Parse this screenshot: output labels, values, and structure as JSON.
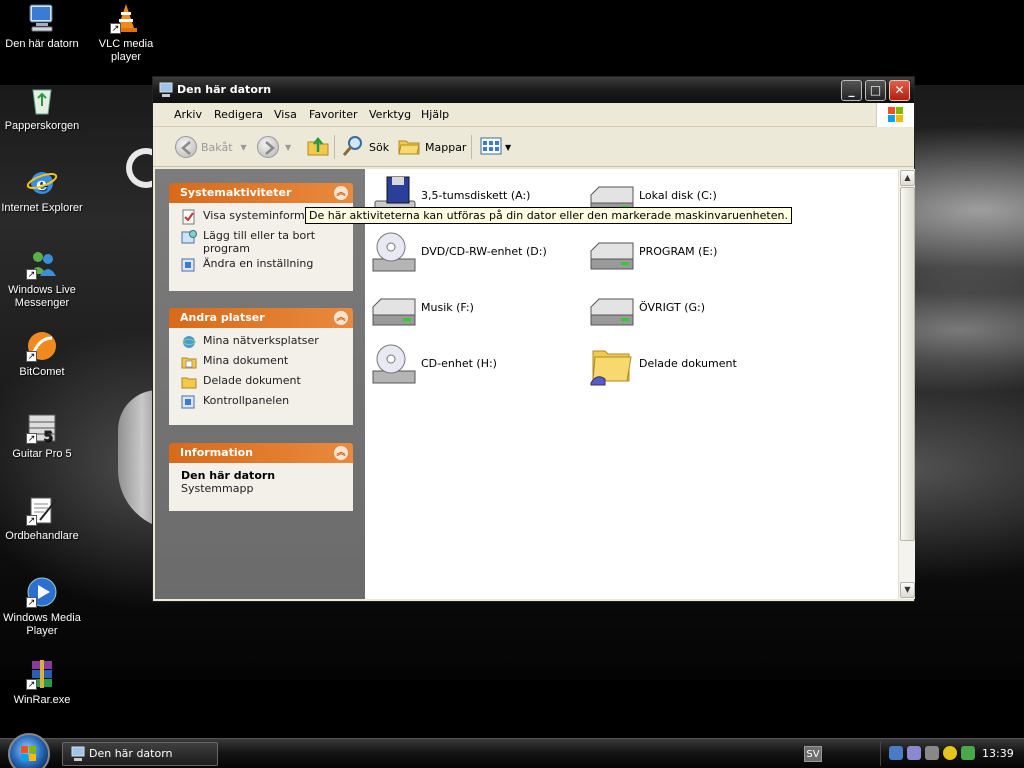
{
  "desktop": {
    "icons": [
      {
        "label": "Den här datorn",
        "icon": "computer-icon"
      },
      {
        "label": "VLC media player",
        "icon": "vlc-icon"
      },
      {
        "label": "Papperskorgen",
        "icon": "recycle-bin-icon"
      },
      {
        "label": "Internet Explorer",
        "icon": "internet-explorer-icon"
      },
      {
        "label": "Windows Live Messenger",
        "icon": "messenger-icon"
      },
      {
        "label": "BitComet",
        "icon": "bitcomet-icon"
      },
      {
        "label": "Guitar Pro 5",
        "icon": "guitar-pro-icon"
      },
      {
        "label": "Ordbehandlare",
        "icon": "word-processor-icon"
      },
      {
        "label": "Windows Media Player",
        "icon": "media-player-icon"
      },
      {
        "label": "WinRar.exe",
        "icon": "winrar-icon"
      }
    ]
  },
  "window": {
    "title": "Den här datorn",
    "menu": [
      "Arkiv",
      "Redigera",
      "Visa",
      "Favoriter",
      "Verktyg",
      "Hjälp"
    ],
    "toolbar": {
      "back": "Bakåt",
      "search": "Sök",
      "folders": "Mappar"
    },
    "panels": {
      "system": {
        "title": "Systemaktiviteter",
        "items": [
          "Visa systeminformation",
          "Lägg till eller ta bort program",
          "Ändra en inställning"
        ]
      },
      "places": {
        "title": "Andra platser",
        "items": [
          "Mina nätverksplatser",
          "Mina dokument",
          "Delade dokument",
          "Kontrollpanelen"
        ]
      },
      "info": {
        "title": "Information",
        "name": "Den här datorn",
        "type": "Systemmapp"
      }
    },
    "items": [
      {
        "label": "3,5-tumsdiskett (A:)",
        "icon": "floppy-icon"
      },
      {
        "label": "Lokal disk (C:)",
        "icon": "hard-drive-icon"
      },
      {
        "label": "DVD/CD-RW-enhet (D:)",
        "icon": "cd-drive-icon"
      },
      {
        "label": "PROGRAM (E:)",
        "icon": "hard-drive-icon"
      },
      {
        "label": "Musik (F:)",
        "icon": "hard-drive-icon"
      },
      {
        "label": "ÖVRIGT (G:)",
        "icon": "hard-drive-icon"
      },
      {
        "label": "CD-enhet (H:)",
        "icon": "cd-drive-icon"
      },
      {
        "label": "Delade dokument",
        "icon": "shared-folder-icon"
      }
    ],
    "tooltip": "De här aktiviteterna kan utföras på din dator eller den markerade maskinvaruenheten."
  },
  "taskbar": {
    "task_label": "Den här datorn",
    "language": "SV",
    "clock": "13:39"
  }
}
